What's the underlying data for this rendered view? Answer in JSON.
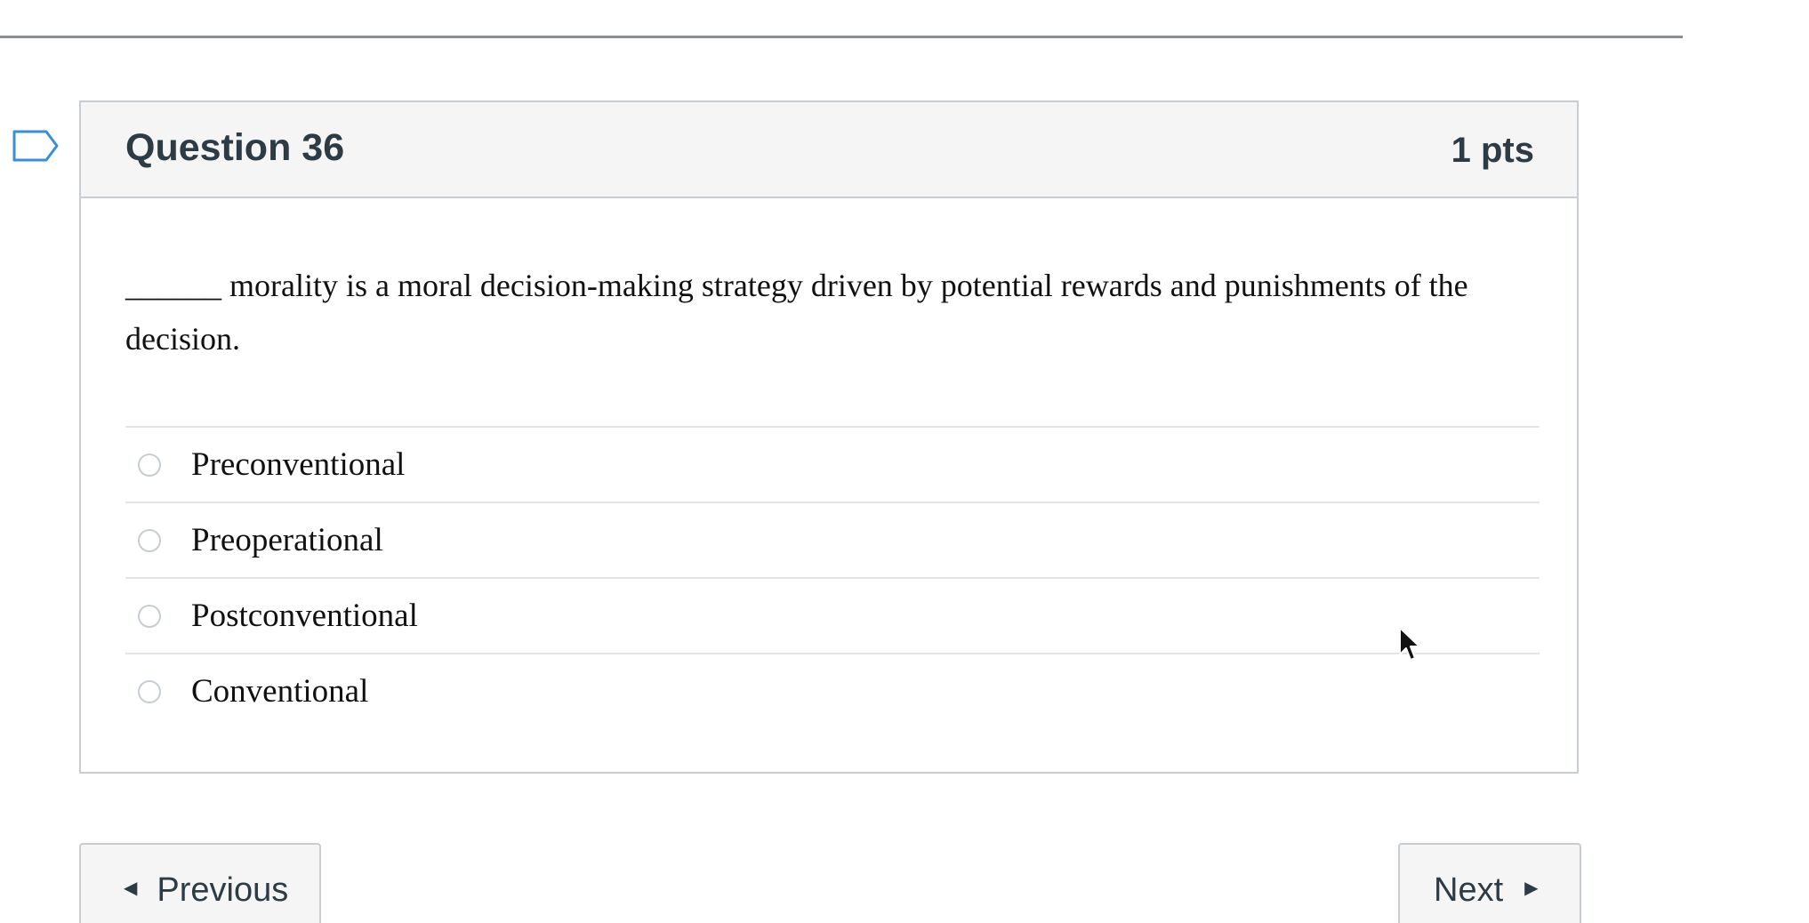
{
  "question": {
    "name": "Question 36",
    "points": "1 pts",
    "blank": "______",
    "text": " morality is a moral decision-making strategy driven by potential rewards and punishments of the decision.",
    "answers": [
      {
        "label": "Preconventional"
      },
      {
        "label": "Preoperational"
      },
      {
        "label": "Postconventional"
      },
      {
        "label": "Conventional"
      }
    ]
  },
  "nav": {
    "previous_label": "Previous",
    "next_label": "Next"
  },
  "icons": {
    "flag": "flag-icon",
    "previous": "triangle-left-icon",
    "next": "triangle-right-icon",
    "cursor": "mouse-pointer-icon"
  },
  "colors": {
    "border": "#c7cdd1",
    "header_bg": "#f5f5f5",
    "text": "#2d3b45"
  }
}
